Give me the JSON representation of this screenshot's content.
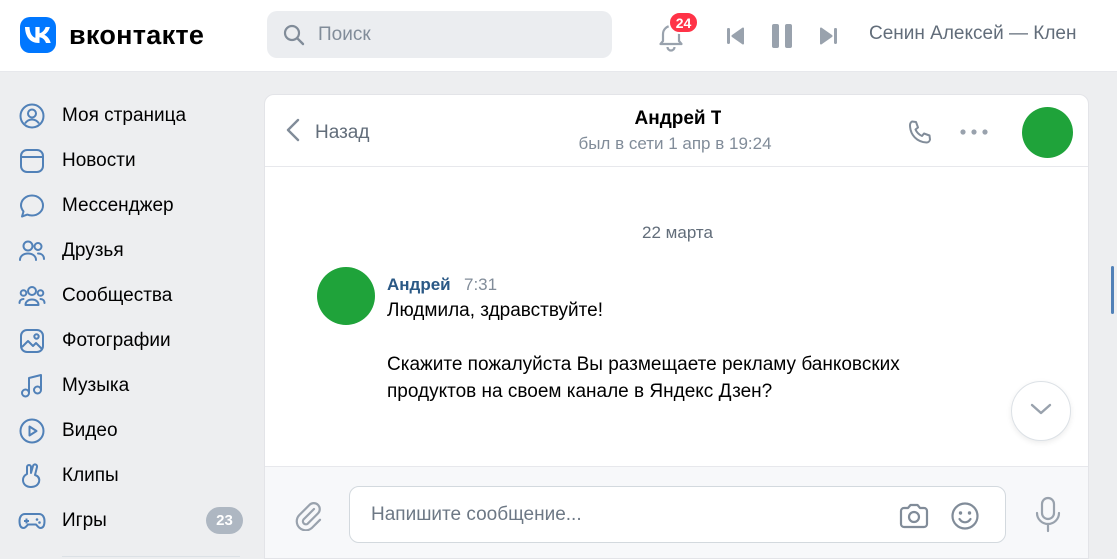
{
  "app": {
    "logo_text": "вконтакте",
    "brand_color": "#0077ff"
  },
  "header": {
    "search_placeholder": "Поиск",
    "notifications_count": "24",
    "now_playing": "Сенин Алексей — Клен"
  },
  "sidebar": {
    "items": [
      {
        "label": "Моя страница",
        "icon": "user-circle-icon"
      },
      {
        "label": "Новости",
        "icon": "news-icon"
      },
      {
        "label": "Мессенджер",
        "icon": "message-bubble-icon"
      },
      {
        "label": "Друзья",
        "icon": "friends-icon"
      },
      {
        "label": "Сообщества",
        "icon": "communities-icon"
      },
      {
        "label": "Фотографии",
        "icon": "photo-icon"
      },
      {
        "label": "Музыка",
        "icon": "music-icon"
      },
      {
        "label": "Видео",
        "icon": "video-play-icon"
      },
      {
        "label": "Клипы",
        "icon": "clips-icon"
      },
      {
        "label": "Игры",
        "icon": "gamepad-icon",
        "count": "23"
      }
    ]
  },
  "chat": {
    "back_label": "Назад",
    "peer_name": "Андрей Т",
    "peer_status": "был в сети 1 апр в 19:24",
    "date_separator": "22 марта",
    "message": {
      "author": "Андрей",
      "time": "7:31",
      "lines": [
        "Людмила, здравствуйте!",
        "",
        "Скажите пожалуйста Вы размещаете рекламу банковских",
        "продуктов на своем канале в Яндекс Дзен?"
      ]
    },
    "composer_placeholder": "Напишите сообщение..."
  }
}
